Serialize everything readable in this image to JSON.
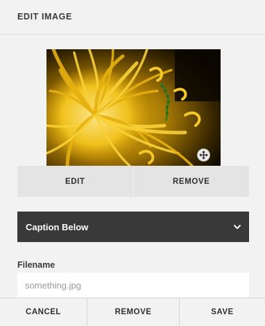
{
  "header": {
    "title": "EDIT IMAGE"
  },
  "image": {
    "alt": "Yellow flower close-up",
    "move_icon": "move-arrows-icon"
  },
  "image_actions": {
    "edit_label": "EDIT",
    "remove_label": "REMOVE"
  },
  "caption_select": {
    "value": "Caption Below",
    "icon": "chevron-down-icon"
  },
  "filename_field": {
    "label": "Filename",
    "value": "",
    "placeholder": "something.jpg"
  },
  "footer": {
    "cancel_label": "CANCEL",
    "remove_label": "REMOVE",
    "save_label": "SAVE"
  },
  "colors": {
    "panel_bg": "#f2f2f2",
    "button_bg": "#e4e4e4",
    "select_bg": "#393939",
    "flower_yellow": "#f2c21b"
  }
}
